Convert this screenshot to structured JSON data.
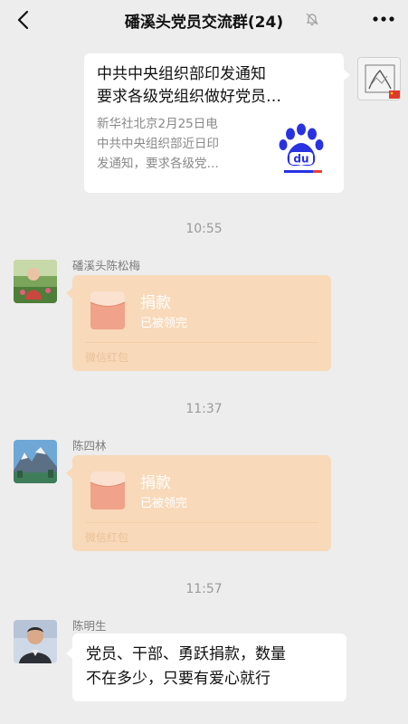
{
  "header": {
    "title": "磻溪头党员交流群(24)",
    "back_icon": "chevron-left-icon",
    "mute_icon": "bell-mute-icon",
    "more_icon": "more-dots-icon"
  },
  "messages": [
    {
      "type": "link_card",
      "side": "right",
      "title_lines": [
        "中共中央组织部印发通知",
        "要求各级党组织做好党员…"
      ],
      "desc_lines": [
        "新华社北京2月25日电",
        "中共中央组织部近日印",
        "发通知，要求各级党…"
      ],
      "thumb_icon": "baidu-logo-icon",
      "thumb_text": "du"
    },
    {
      "type": "time",
      "text": "10:55"
    },
    {
      "type": "red_packet",
      "sender": "磻溪头陈松梅",
      "title": "捐款",
      "status": "已被领完",
      "footer": "微信红包"
    },
    {
      "type": "time",
      "text": "11:37"
    },
    {
      "type": "red_packet",
      "sender": "陈四林",
      "title": "捐款",
      "status": "已被领完",
      "footer": "微信红包"
    },
    {
      "type": "time",
      "text": "11:57"
    },
    {
      "type": "text",
      "sender": "陈明生",
      "lines": [
        "党员、干部、勇跃捐款，数量",
        "不在多少，只要有爱心就行"
      ]
    }
  ],
  "colors": {
    "background": "#ededed",
    "red_packet": "#f8d9b9",
    "red_packet_icon": "#e96b4f",
    "baidu_blue": "#2932e1"
  }
}
